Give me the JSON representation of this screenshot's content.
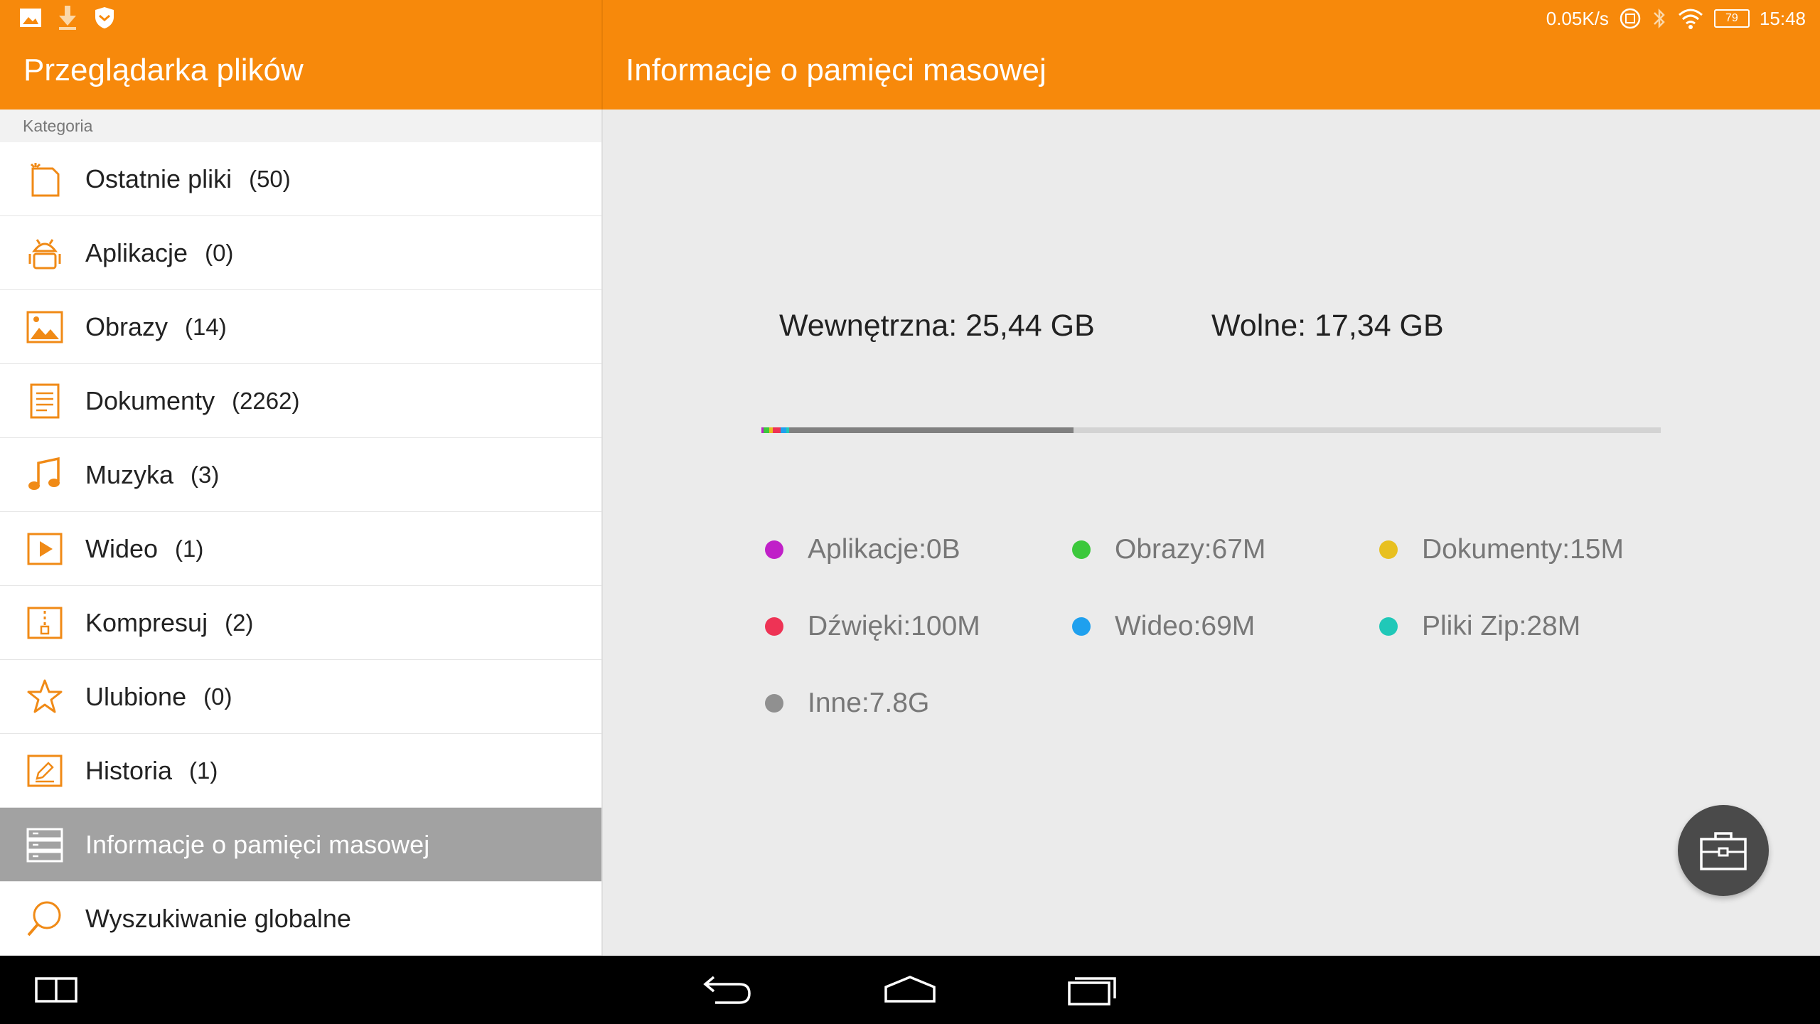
{
  "colors": {
    "accent": "#f7890b",
    "icon_orange": "#f08a16",
    "active_row": "#a2a2a2"
  },
  "status": {
    "speed": "0.05K/s",
    "battery": "79",
    "time": "15:48"
  },
  "left_panel": {
    "title": "Przeglądarka plików",
    "category_label": "Kategoria",
    "items": [
      {
        "label": "Ostatnie pliki",
        "count": "(50)",
        "icon": "recent-file-icon"
      },
      {
        "label": "Aplikacje",
        "count": "(0)",
        "icon": "android-icon"
      },
      {
        "label": "Obrazy",
        "count": "(14)",
        "icon": "image-icon"
      },
      {
        "label": "Dokumenty",
        "count": "(2262)",
        "icon": "document-icon"
      },
      {
        "label": "Muzyka",
        "count": "(3)",
        "icon": "music-icon"
      },
      {
        "label": "Wideo",
        "count": "(1)",
        "icon": "video-icon"
      },
      {
        "label": "Kompresuj",
        "count": "(2)",
        "icon": "zip-icon"
      },
      {
        "label": "Ulubione",
        "count": "(0)",
        "icon": "star-icon"
      },
      {
        "label": "Historia",
        "count": "(1)",
        "icon": "history-icon"
      },
      {
        "label": "Informacje o pamięci masowej",
        "count": "",
        "icon": "storage-icon"
      },
      {
        "label": "Wyszukiwanie globalne",
        "count": "",
        "icon": "search-icon"
      }
    ]
  },
  "right_panel": {
    "title": "Informacje o pamięci masowej",
    "internal": "Wewnętrzna: 25,44 GB",
    "free": "Wolne: 17,34 GB",
    "usage_fraction": 0.346,
    "bar_segments": [
      {
        "color": "#c020c8",
        "fraction": 0.002
      },
      {
        "color": "#3cc83c",
        "fraction": 0.006
      },
      {
        "color": "#e8c020",
        "fraction": 0.004
      },
      {
        "color": "#ee3355",
        "fraction": 0.009
      },
      {
        "color": "#1fa0ee",
        "fraction": 0.006
      },
      {
        "color": "#20c8b8",
        "fraction": 0.003
      },
      {
        "color": "#808080",
        "fraction": 0.316
      }
    ],
    "legend": [
      {
        "label": "Aplikacje:0B",
        "color": "#c020c8"
      },
      {
        "label": "Obrazy:67M",
        "color": "#3cc83c"
      },
      {
        "label": "Dokumenty:15M",
        "color": "#e8c020"
      },
      {
        "label": "Dźwięki:100M",
        "color": "#ee3355"
      },
      {
        "label": "Wideo:69M",
        "color": "#1fa0ee"
      },
      {
        "label": "Pliki Zip:28M",
        "color": "#20c8b8"
      },
      {
        "label": "Inne:7.8G",
        "color": "#909090"
      }
    ]
  }
}
